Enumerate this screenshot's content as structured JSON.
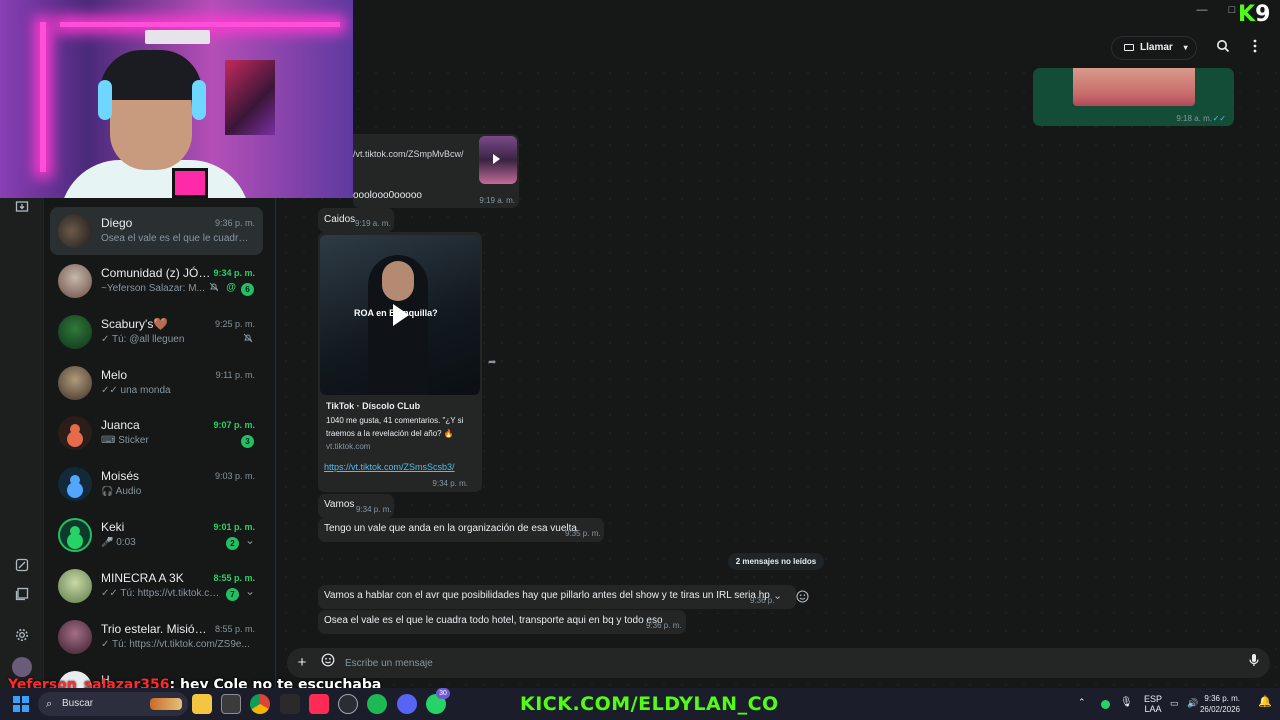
{
  "window": {
    "minimize_glyph": "—",
    "maximize_glyph": "□",
    "stream_logo_k": "K",
    "stream_logo_num": "9"
  },
  "rail": {
    "icons": [
      "archive-icon",
      "status-icon",
      "media-icon",
      "settings-icon"
    ]
  },
  "chats": [
    {
      "name": "Diego",
      "time": "9:36 p. m.",
      "preview": "Osea el vale es el que le cuadra to...",
      "unread": false,
      "active": true
    },
    {
      "name": "Comunidad (z) JÓVE...",
      "time": "9:34 p. m.",
      "preview": "~Yeferson Salazar: M...",
      "unread": true,
      "badge": "6",
      "muted": true,
      "mention": "@"
    },
    {
      "name": "Scabury's🤎",
      "time": "9:25 p. m.",
      "preview": "✓ Tú: @all lleguen",
      "unread": false,
      "muted": true
    },
    {
      "name": "Melo",
      "time": "9:11 p. m.",
      "preview": "✓✓ una monda",
      "unread": false
    },
    {
      "name": "Juanca",
      "time": "9:07 p. m.",
      "preview": "⌨ Sticker",
      "unread": true,
      "badge": "3"
    },
    {
      "name": "Moisés",
      "time": "9:03 p. m.",
      "preview": "🎧 Audio",
      "unread": false
    },
    {
      "name": "Keki",
      "time": "9:01 p. m.",
      "preview": "🎤 0:03",
      "unread": true,
      "badge": "2",
      "chevron": "⌄"
    },
    {
      "name": "MINECRA A 3K",
      "time": "8:55 p. m.",
      "preview": "✓✓ Tú: https://vt.tiktok.com...",
      "unread": true,
      "badge": "7",
      "chevron": "⌄"
    },
    {
      "name": "Trio estelar. Misión: R...",
      "time": "8:55 p. m.",
      "preview": "✓ Tú: https://vt.tiktok.com/ZS9e...",
      "unread": false
    },
    {
      "name": "H",
      "time": "",
      "preview": "",
      "unread": false
    }
  ],
  "header": {
    "call_label": "Llamar",
    "chevron": "▾"
  },
  "messages": {
    "out_top_time": "9:18 a. m.",
    "tiktok_link_top": "/vt.tiktok.com/ZSmpMvBcw/",
    "ooo_text": "ooolooo0ooooo",
    "ooo_time": "9:19 a. m.",
    "caidos_text": "Caidos",
    "caidos_time": "9:19 a. m.",
    "video_overlay": "ROA en B...nquilla?",
    "preview_title": "TikTok · Díscolo CLub",
    "preview_desc": "1040 me gusta, 41 comentarios. \"¿Y si traemos a la revelación del año? 🔥",
    "preview_domain": "vt.tiktok.com",
    "preview_link": "https://vt.tiktok.com/ZSmsScsb3/",
    "preview_time": "9:34 p. m.",
    "vamos_text": "Vamos",
    "vamos_time": "9:34 p. m.",
    "vale_text": "Tengo un vale que anda en la organización de esa vuelta",
    "vale_time": "9:35 p. m.",
    "unread_divider": "2 mensajes no leídos",
    "avr_text": "Vamos a hablar con el avr que posibilidades hay que pillarlo antes del show y te tiras un IRL seria hp",
    "avr_time": "9:36 p.",
    "osea_text": "Osea el vale es el que le cuadra todo hotel, transporte aqui en bq y todo eso",
    "osea_time": "9:36 p. m."
  },
  "composer": {
    "placeholder": "Escribe un mensaje",
    "plus": "+",
    "mic": "🎙"
  },
  "stream_overlay": {
    "chat_user": "Yeferson_salazar356",
    "chat_message": ": hey Cole no te escuchaba",
    "banner": "KICK.COM/ELDYLAN_CO"
  },
  "taskbar": {
    "search_label": "Buscar",
    "badge_count": "30",
    "lang_top": "ESP",
    "lang_bottom": "LAA",
    "clock_time": "9:36 p. m.",
    "clock_date": "26/02/2026"
  },
  "colors": {
    "accent_green": "#25d366",
    "kick_green": "#53fc18",
    "chat_user_red": "#ff2a2a"
  }
}
